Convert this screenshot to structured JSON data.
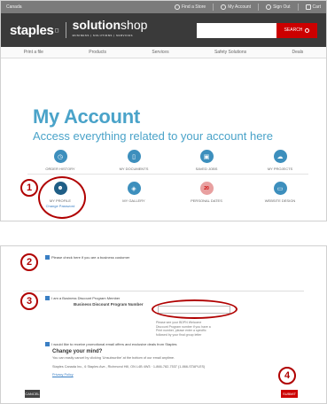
{
  "topbar": {
    "country": "Canada",
    "links": [
      {
        "label": "Find a Store",
        "icon": "location-icon"
      },
      {
        "label": "My Account",
        "icon": "user-icon"
      },
      {
        "label": "Sign Out",
        "icon": "signout-icon"
      },
      {
        "label": "Cart",
        "icon": "cart-icon"
      }
    ]
  },
  "header": {
    "brand": "staples",
    "sub_brand_bold": "solution",
    "sub_brand_light": "shop",
    "sub_brand_tagline": "BUSINESS | SOLUTIONS | SERVICES",
    "search_placeholder": "",
    "search_button": "SEARCH"
  },
  "nav": [
    "Print a file",
    "Products",
    "Services",
    "Safety Solutions",
    "Deals"
  ],
  "hero": {
    "title": "My Account",
    "subtitle": "Access everything related to your account here"
  },
  "tiles": [
    {
      "label": "ORDER HISTORY",
      "icon": "clock-icon"
    },
    {
      "label": "MY DOCUMENTS",
      "icon": "document-icon"
    },
    {
      "label": "SAVED JOBS",
      "icon": "save-icon"
    },
    {
      "label": "MY PROJECTS",
      "icon": "cloud-icon"
    },
    {
      "label": "MY PROFILE",
      "link": "Change Password",
      "icon": "profile-icon"
    },
    {
      "label": "MY GALLERY",
      "icon": "gallery-icon"
    },
    {
      "label": "PERSONAL DATES",
      "icon": "calendar-icon",
      "icon_text": "20"
    },
    {
      "label": "WEBSITE DESIGN",
      "icon": "monitor-icon"
    }
  ],
  "annotations": [
    "1",
    "2",
    "3",
    "4"
  ],
  "form": {
    "business_check": "Please check here if you are a business customer",
    "bdpn_member": "I am a Business Discount Program Member",
    "bdpn_label": "Business Discount Program Number",
    "bdpn_help": [
      "Please see your BDPN Welcome",
      "Discount Program number if you have a",
      "Print number, please enter a specific",
      "followed by your final group letter"
    ],
    "promo_check": "I would like to receive promotional email offers and exclusive deals from Staples",
    "change_mind_title": "Change your mind?",
    "change_mind_text": "You can easily cancel by clicking 'Unsubscribe' at the bottom of our email anytime.",
    "address": "Staples Canada Inc., 6 Staples Ave., Richmond Hill, ON L4B 4W3 · 1-866-782-7537 (1-866-STAPLES)",
    "privacy": "Privacy Policy",
    "cancel": "CANCEL",
    "submit": "SUBMIT"
  },
  "colors": {
    "accent": "#4aa3c9",
    "brand_red": "#cc0000",
    "annotation": "#b00000",
    "header_bg": "#3a3a3a"
  }
}
